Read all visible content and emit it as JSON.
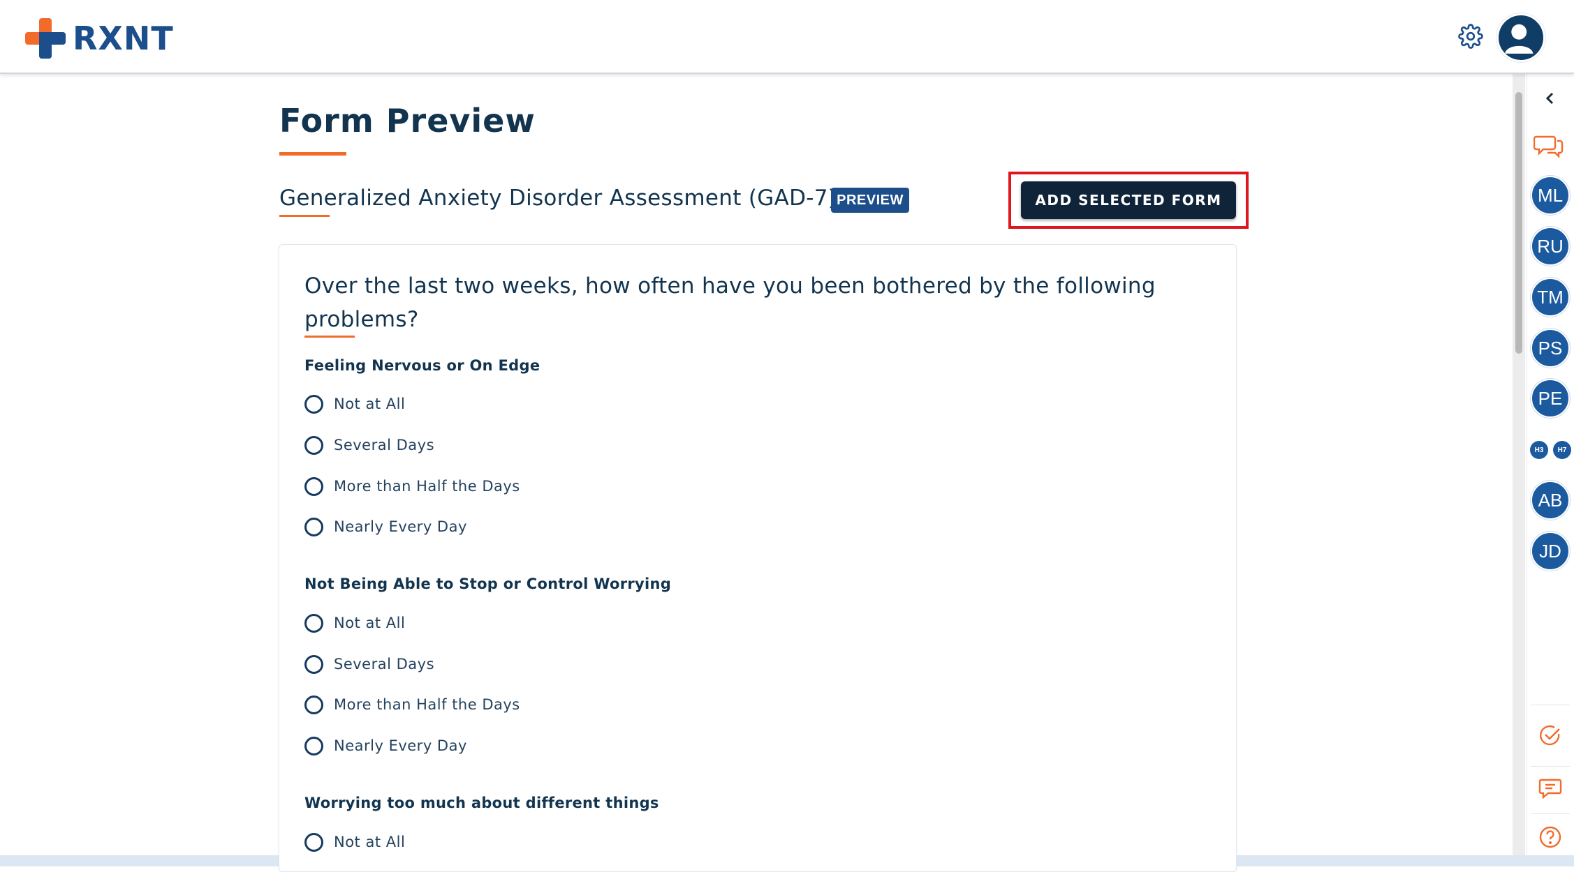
{
  "header": {
    "logo_text": "RXNT"
  },
  "page": {
    "title": "Form Preview",
    "form_name": "Generalized Anxiety Disorder Assessment (GAD-7)",
    "preview_badge": "PREVIEW",
    "add_button": "ADD SELECTED FORM"
  },
  "question": {
    "title": "Over the last two weeks, how often have you been bothered by the following problems?"
  },
  "items": [
    {
      "label": "Feeling Nervous or On Edge",
      "options": [
        "Not at All",
        "Several Days",
        "More than Half the Days",
        "Nearly Every Day"
      ]
    },
    {
      "label": "Not Being Able to Stop or Control Worrying",
      "options": [
        "Not at All",
        "Several Days",
        "More than Half the Days",
        "Nearly Every Day"
      ]
    },
    {
      "label": "Worrying too much about different things",
      "options": [
        "Not at All"
      ]
    }
  ],
  "rail": {
    "users": [
      "ML",
      "RU",
      "TM",
      "PS",
      "PE"
    ],
    "small_users": [
      "H3",
      "H7"
    ],
    "users_bottom": [
      "AB",
      "JD"
    ]
  },
  "colors": {
    "brand_blue": "#1c4e8c",
    "accent_orange": "#f26b2a",
    "button_dark": "#0f2438",
    "highlight_red": "#e0161e"
  },
  "icons": [
    "settings-gear-icon",
    "user-avatar-icon",
    "chevron-left-icon",
    "chat-bubbles-icon",
    "check-circle-icon",
    "message-icon",
    "help-icon"
  ]
}
